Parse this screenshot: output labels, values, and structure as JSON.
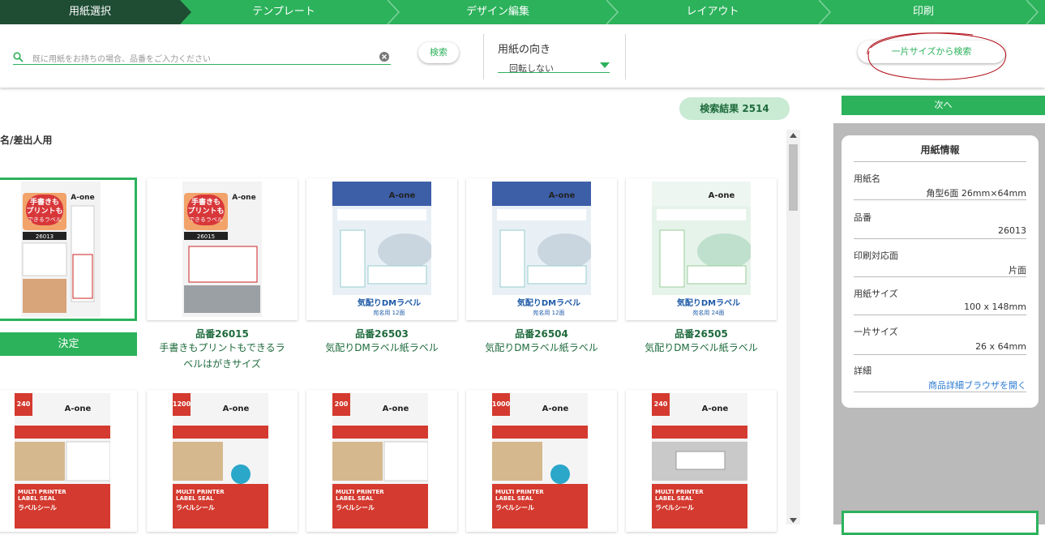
{
  "wizard": {
    "steps": [
      {
        "label": "用紙選択",
        "active": true
      },
      {
        "label": "テンプレート",
        "active": false
      },
      {
        "label": "デザイン編集",
        "active": false
      },
      {
        "label": "レイアウト",
        "active": false
      },
      {
        "label": "印刷",
        "active": false
      }
    ],
    "active_color": "#1f4d33",
    "color": "#2cb25b"
  },
  "search": {
    "placeholder": "既に用紙をお持ちの場合、品番をご入力ください",
    "button_label": "検索"
  },
  "orientation": {
    "title": "用紙の向き",
    "selected": "回転しない"
  },
  "size_search_button": "一片サイズから検索",
  "results": {
    "label": "検索結果 2514"
  },
  "category": "名/差出人用",
  "decide_button": "決定",
  "next_button": "次へ",
  "products_row1": [
    {
      "code": "",
      "name": "",
      "selected": true,
      "variant": "handwrite",
      "product_no": "26013"
    },
    {
      "code": "品番26015",
      "name": "手書きもプリントもできるラベルはがきサイズ",
      "variant": "handwrite",
      "product_no": "26015"
    },
    {
      "code": "品番26503",
      "name": "気配りDMラベル紙ラベル",
      "variant": "dm-blue",
      "product_no": "26503",
      "tagline": "宛名用 12面"
    },
    {
      "code": "品番26504",
      "name": "気配りDMラベル紙ラベル",
      "variant": "dm-blue",
      "product_no": "26504",
      "tagline": "宛名用 12面"
    },
    {
      "code": "品番26505",
      "name": "気配りDMラベル紙ラベル",
      "variant": "dm-green",
      "product_no": "26505",
      "tagline": "宛名用 24面"
    }
  ],
  "products_row2": [
    {
      "count": "240",
      "variant": "multi"
    },
    {
      "count": "1200",
      "variant": "multi"
    },
    {
      "count": "200",
      "variant": "multi"
    },
    {
      "count": "1000",
      "variant": "multi"
    },
    {
      "count": "240",
      "variant": "multi"
    }
  ],
  "paper_info": {
    "title": "用紙情報",
    "fields": [
      {
        "label": "用紙名",
        "value": "角型6面 26mm×64mm"
      },
      {
        "label": "品番",
        "value": "26013"
      },
      {
        "label": "印刷対応面",
        "value": "片面"
      },
      {
        "label": "用紙サイズ",
        "value": "100 x 148mm"
      },
      {
        "label": "一片サイズ",
        "value": "26 x 64mm"
      },
      {
        "label": "詳細",
        "value": "商品詳細ブラウザを開く"
      }
    ]
  },
  "brand": "A-one",
  "label_texts": {
    "dm_title": "気配りDMラベル",
    "multi_line1": "MULTI PRINTER",
    "multi_line2": "LABEL SEAL",
    "multi_jp": "ラベルシール",
    "handwrite_line1": "手書きも",
    "handwrite_line2": "プリントも",
    "handwrite_line3": "できるラベル"
  }
}
